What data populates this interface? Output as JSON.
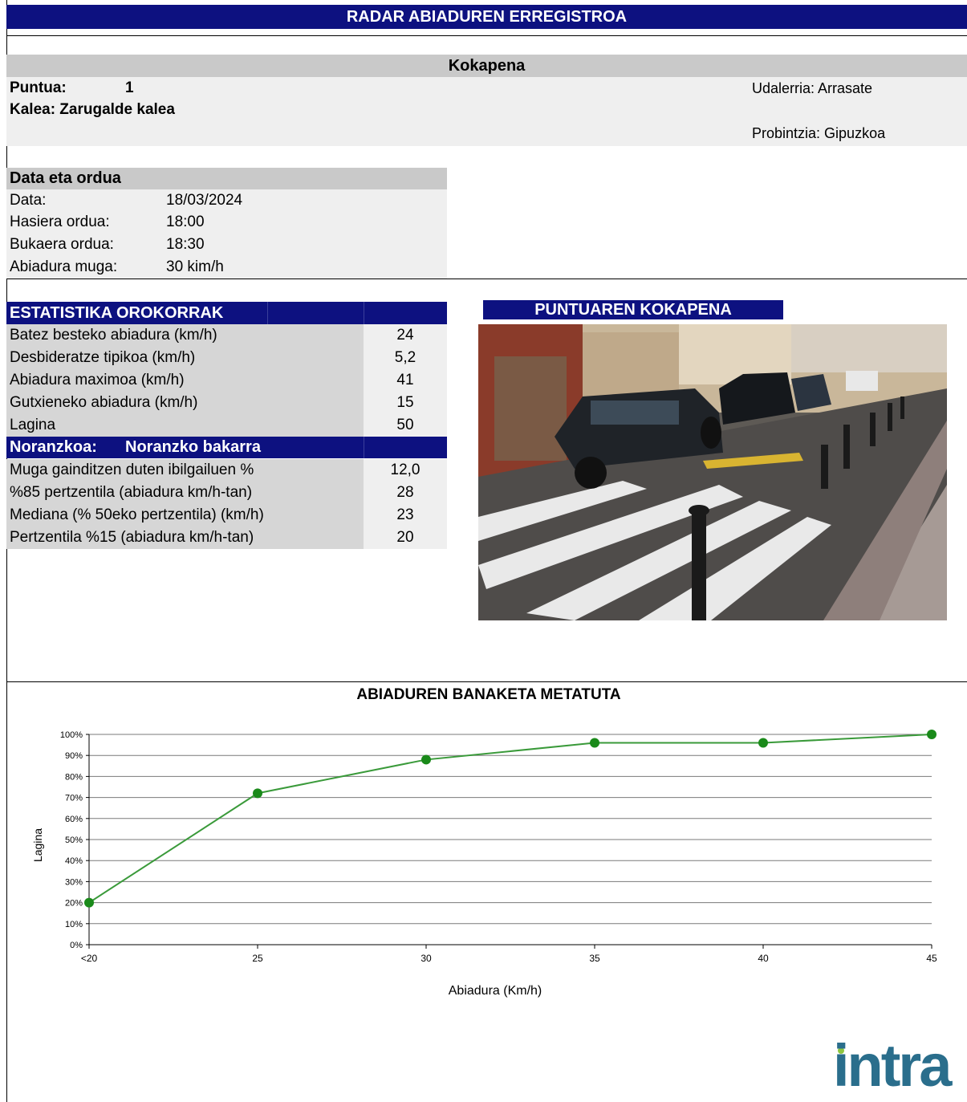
{
  "header": {
    "title": "RADAR ABIADUREN ERREGISTROA"
  },
  "location": {
    "section_title": "Kokapena",
    "point_label": "Puntua:",
    "point_value": "1",
    "street": "Kalea: Zarugalde kalea",
    "municipality": "Udalerria: Arrasate",
    "province": "Probintzia: Gipuzkoa"
  },
  "datetime": {
    "section_title": "Data eta ordua",
    "rows": [
      {
        "label": "Data:",
        "value": "18/03/2024"
      },
      {
        "label": "Hasiera ordua:",
        "value": "18:00"
      },
      {
        "label": "Bukaera ordua:",
        "value": "18:30"
      },
      {
        "label": "Abiadura muga:",
        "value": "30 kim/h"
      }
    ]
  },
  "stats": {
    "title": "ESTATISTIKA OROKORRAK",
    "rows": [
      {
        "label": "Batez besteko abiadura (km/h)",
        "value": "24"
      },
      {
        "label": "Desbideratze tipikoa (km/h)",
        "value": "5,2"
      },
      {
        "label": "Abiadura maximoa (km/h)",
        "value": "41"
      },
      {
        "label": "Gutxieneko abiadura (km/h)",
        "value": "15"
      },
      {
        "label": "Lagina",
        "value": "50"
      }
    ],
    "direction_label": "Noranzkoa:",
    "direction_value": "Noranzko bakarra",
    "rows2": [
      {
        "label": "Muga gainditzen duten ibilgailuen %",
        "value": "12,0"
      },
      {
        "label": "%85 pertzentila (abiadura km/h-tan)",
        "value": "28"
      },
      {
        "label": "Mediana (% 50eko pertzentila) (km/h)",
        "value": "23"
      },
      {
        "label": "Pertzentila %15 (abiadura km/h-tan)",
        "value": "20"
      }
    ]
  },
  "photo": {
    "title": "PUNTUAREN KOKAPENA"
  },
  "chart_data": {
    "type": "line",
    "title": "ABIADUREN BANAKETA METATUTA",
    "xlabel": "Abiadura (Km/h)",
    "ylabel": "Lagina",
    "categories": [
      "<20",
      "25",
      "30",
      "35",
      "40",
      "45"
    ],
    "values": [
      20,
      72,
      88,
      96,
      96,
      100
    ],
    "y_ticks": [
      "0%",
      "10%",
      "20%",
      "30%",
      "40%",
      "50%",
      "60%",
      "70%",
      "80%",
      "90%",
      "100%"
    ],
    "ylim": [
      0,
      100
    ],
    "grid": true,
    "line_color": "#3a9a3a",
    "marker_color": "#1a8a1a"
  },
  "logo": {
    "text": "intra",
    "color": "#2a6e8c",
    "dot_color": "#8dc63f"
  }
}
